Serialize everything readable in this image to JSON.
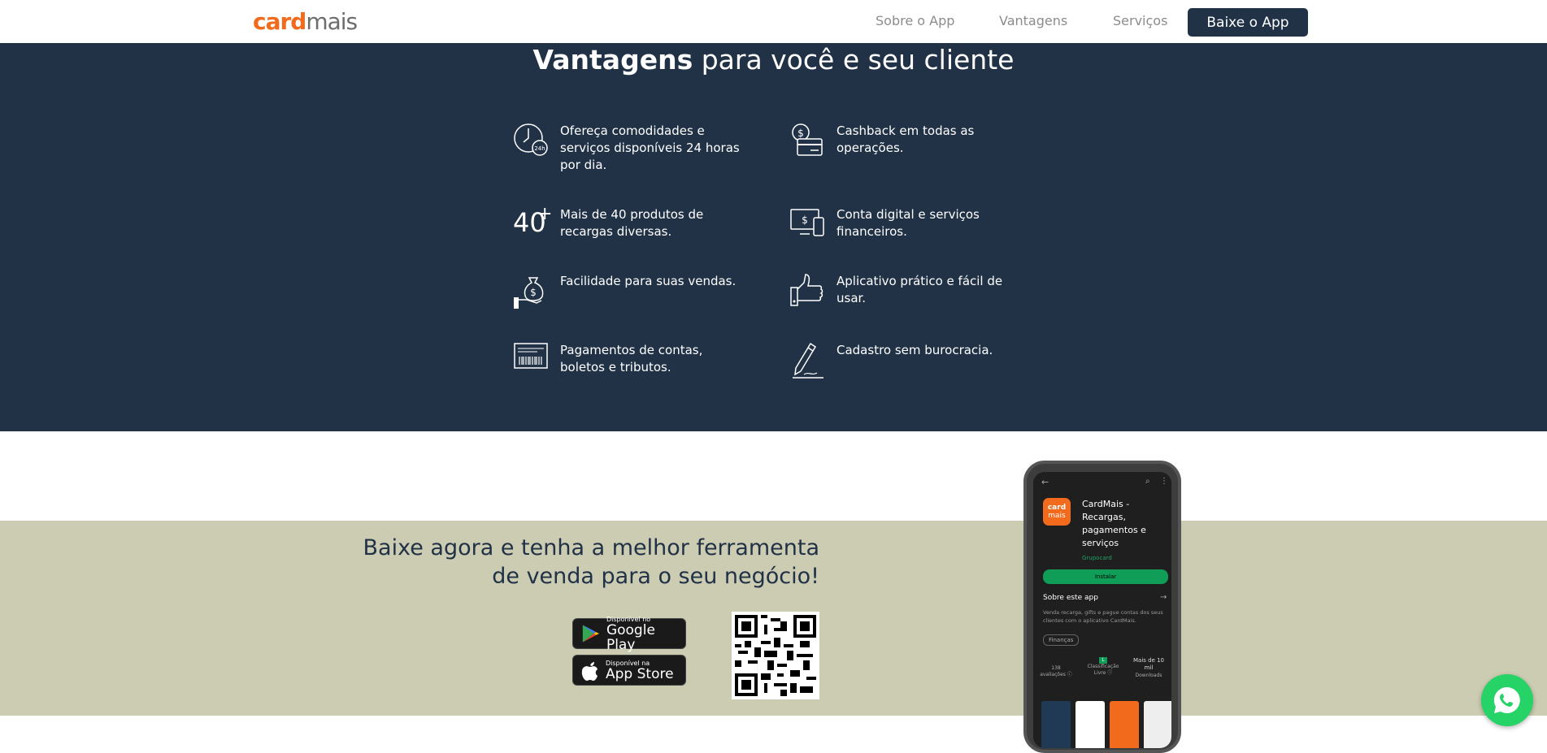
{
  "brand": {
    "logo_a": "card",
    "logo_b": "mais",
    "accent": "#f26b1d",
    "navy": "#213247",
    "beige": "#ccccb2"
  },
  "nav": {
    "items": [
      "Sobre o App",
      "Vantagens",
      "Serviços"
    ],
    "cta": "Baixe o App"
  },
  "vantagens": {
    "title_bold": "Vantagens",
    "title_rest": " para você e seu cliente",
    "features": [
      {
        "icon": "clock-24h-icon",
        "text": "Ofereça comodidades e serviços disponíveis 24 horas por dia."
      },
      {
        "icon": "cashback-card-icon",
        "text": "Cashback em todas as operações."
      },
      {
        "icon": "forty-plus-icon",
        "text": "Mais de 40 produtos de recargas diversas."
      },
      {
        "icon": "digital-account-icon",
        "text": "Conta digital e serviços financeiros."
      },
      {
        "icon": "money-bag-hand-icon",
        "text": "Facilidade para suas vendas."
      },
      {
        "icon": "thumbs-up-icon",
        "text": "Aplicativo prático e fácil de usar."
      },
      {
        "icon": "barcode-bill-icon",
        "text": "Pagamentos de contas, boletos e tributos."
      },
      {
        "icon": "pencil-sign-icon",
        "text": "Cadastro sem burocracia."
      }
    ],
    "forty_label": "40",
    "forty_plus": "+"
  },
  "download": {
    "title_line1": "Baixe agora e tenha a melhor ferramenta",
    "title_line2": "de venda para o seu negócio!",
    "google": {
      "small": "Disponível no",
      "big": "Google Play"
    },
    "apple": {
      "small": "Disponível na",
      "big": "App Store"
    }
  },
  "phone": {
    "app_name": "CardMais - Recargas, pagamentos e serviços",
    "developer": "Grupocard",
    "install": "Instalar",
    "about": "Sobre este app",
    "desc": "Venda recarga, gifts e pague contas dos seus clientes com o aplicativo CardMais.",
    "tag": "Finanças",
    "stat1_a": "138",
    "stat1_b": "avaliações ⓘ",
    "stat2_a": "L",
    "stat2_b": "Classificação Livre ⓘ",
    "stat3_a": "Mais de 10 mil",
    "stat3_b": "Downloads",
    "icon_a": "card",
    "icon_b": "mais"
  }
}
